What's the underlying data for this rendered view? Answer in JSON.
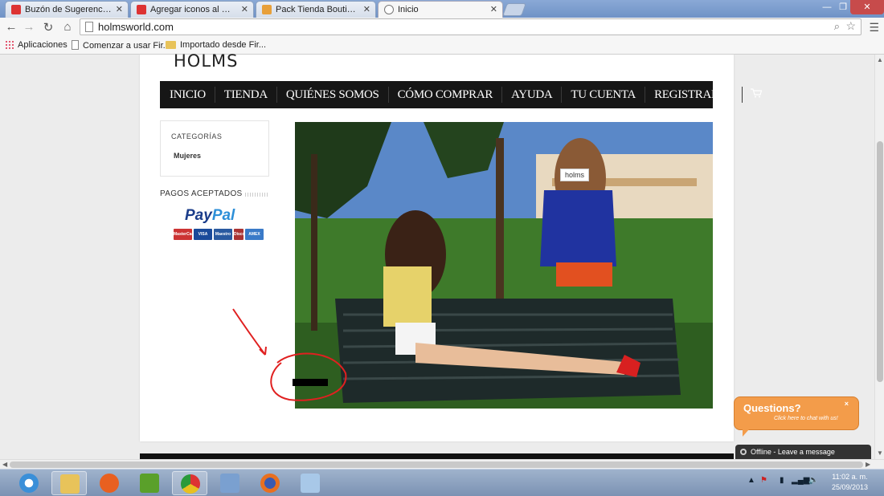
{
  "browser": {
    "tabs": [
      {
        "label": "Buzón de Sugerencias - Fo",
        "active": false
      },
      {
        "label": "Agregar iconos al menu d",
        "active": false
      },
      {
        "label": "Pack Tienda Boutique - Ac",
        "active": false
      },
      {
        "label": "Inicio",
        "active": true
      }
    ],
    "url": "holmsworld.com",
    "bookmarks": [
      "Aplicaciones",
      "Comenzar a usar Fir...",
      "Importado desde Fir..."
    ]
  },
  "site": {
    "logo": "HOLMS",
    "nav": [
      "INICIO",
      "TIENDA",
      "QUIÉNES SOMOS",
      "CÓMO COMPRAR",
      "AYUDA",
      "TU CUENTA",
      "REGISTRARSE"
    ],
    "cart_icon": "cart-icon",
    "categories": {
      "title": "CATEGORÍAS",
      "items": [
        "Mujeres"
      ]
    },
    "payments": {
      "title": "PAGOS ACEPTADOS",
      "paypal_a": "Pay",
      "paypal_b": "Pal",
      "cards": [
        "MasterCard",
        "VISA",
        "Maestro",
        "Discover",
        "AMEX"
      ]
    },
    "hero_tag": "holms"
  },
  "chat": {
    "question": "Questions?",
    "subtitle": "Click here to chat with us!",
    "close": "×",
    "status": "Offline - Leave a message"
  },
  "taskbar": {
    "time": "11:02 a. m.",
    "date": "25/09/2013"
  },
  "colors": {
    "nav_bg": "#161616",
    "chat_orange": "#f39c4a",
    "annotation_red": "#e02020"
  }
}
